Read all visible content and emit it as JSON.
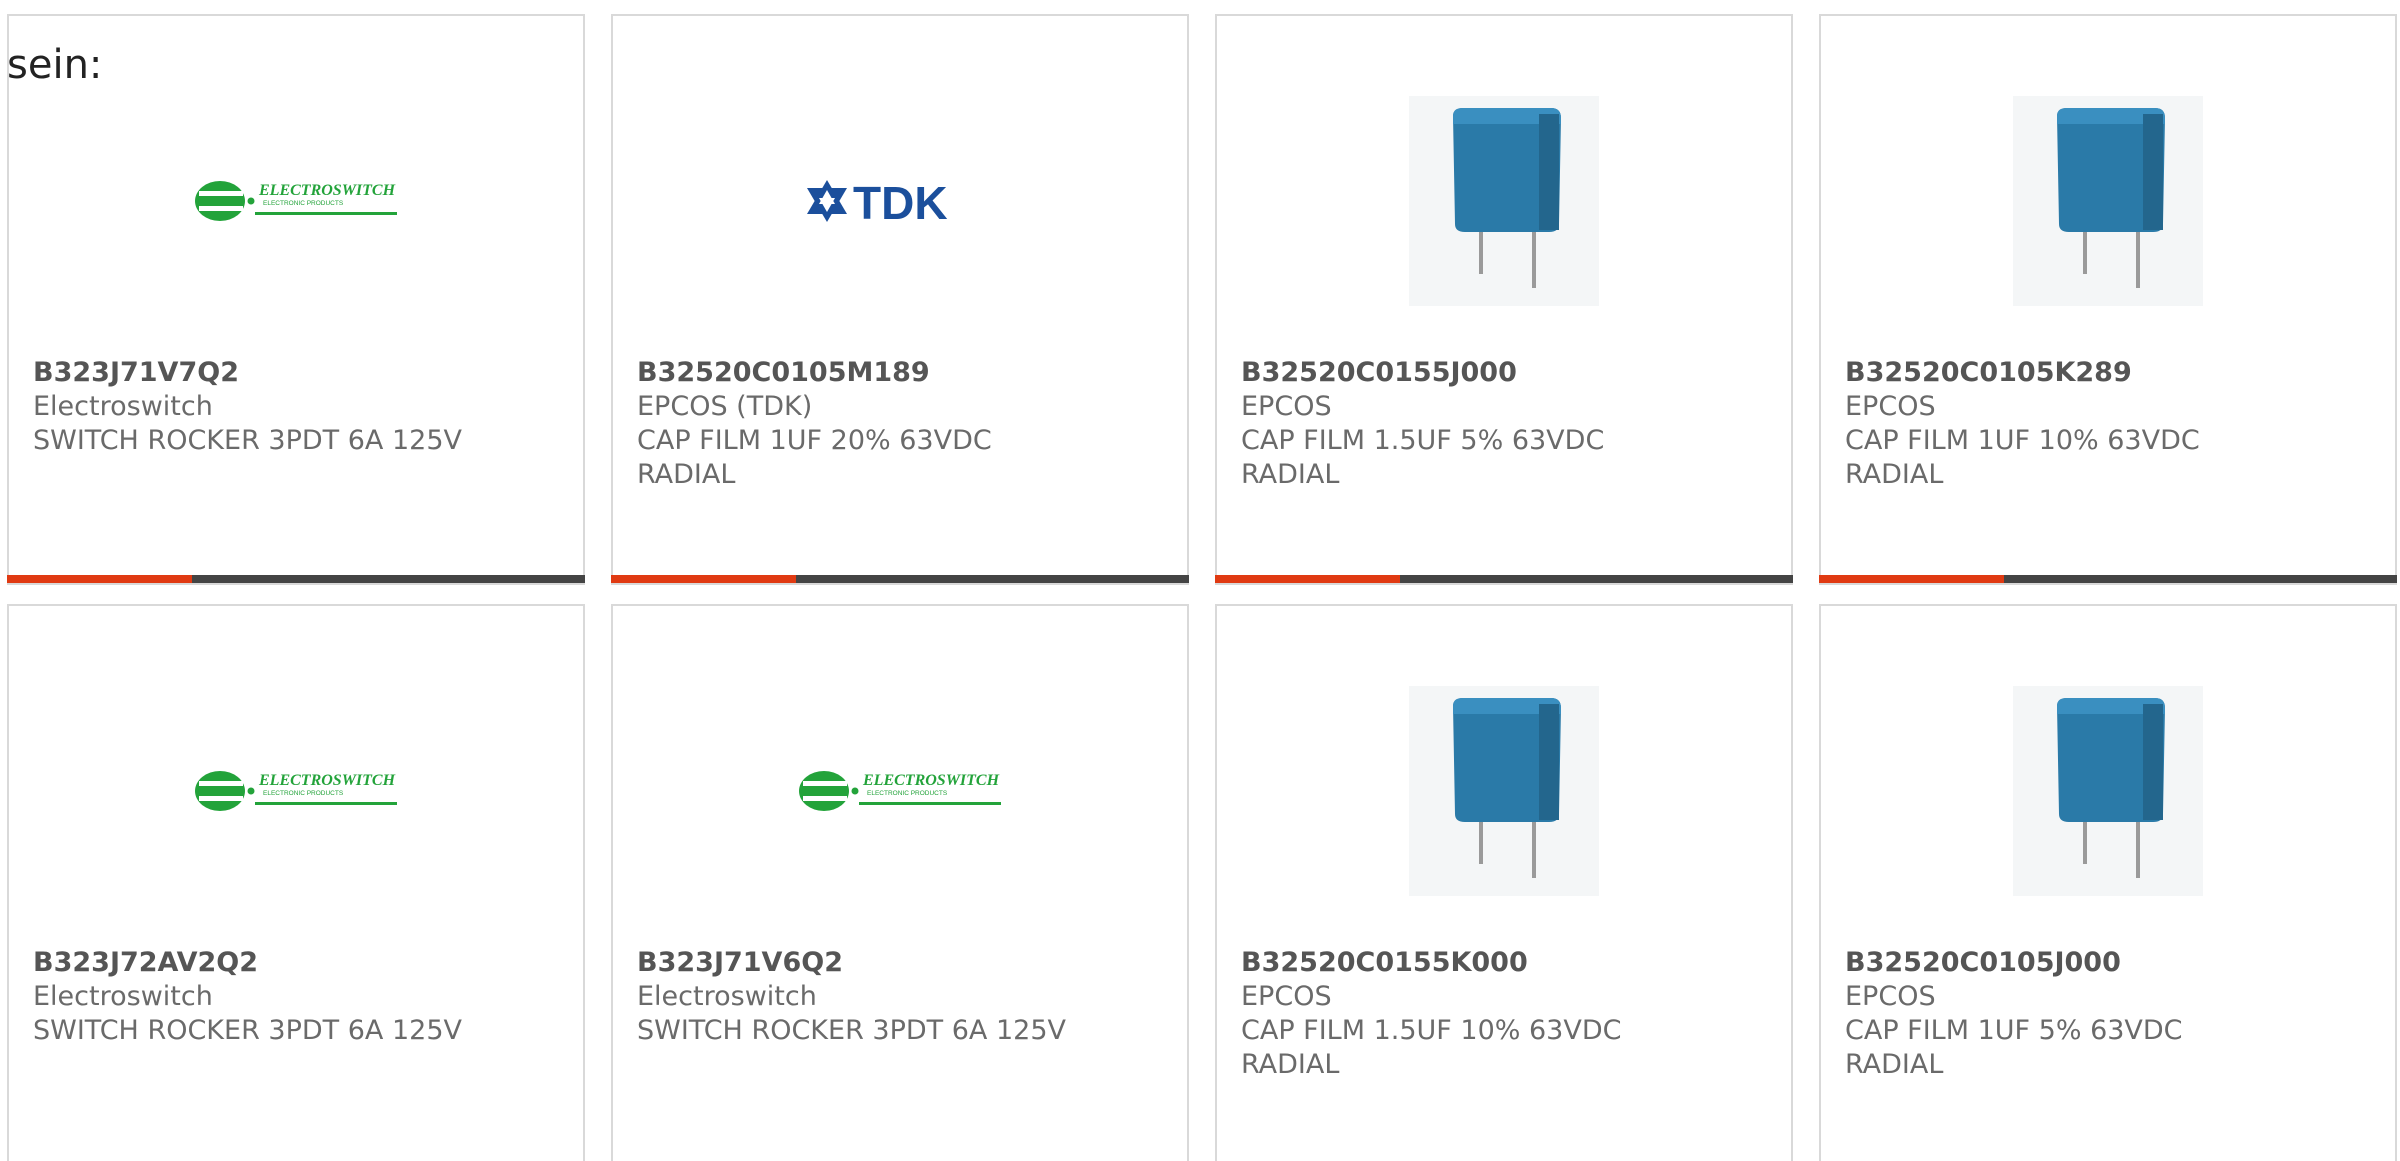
{
  "intro_text": "sein:",
  "colors": {
    "accent": "#e03a12",
    "bar_track": "#444444",
    "electroswitch_green": "#23a33a",
    "tdk_blue": "#1b4f9c",
    "capacitor_blue": "#2a7aa8"
  },
  "cards": [
    {
      "part_number": "B323J71V7Q2",
      "manufacturer": "Electroswitch",
      "desc_1": "SWITCH ROCKER 3PDT 6A 125V",
      "desc_2": "",
      "image": "electroswitch-logo",
      "logo_text": "ELECTROSWITCH",
      "logo_subtext": "ELECTRONIC PRODUCTS",
      "progress": 0.32
    },
    {
      "part_number": "B32520C0105M189",
      "manufacturer": "EPCOS (TDK)",
      "desc_1": "CAP FILM 1UF 20% 63VDC",
      "desc_2": "RADIAL",
      "image": "tdk-logo",
      "logo_text": "TDK",
      "progress": 0.32
    },
    {
      "part_number": "B32520C0155J000",
      "manufacturer": "EPCOS",
      "desc_1": "CAP FILM 1.5UF 5% 63VDC",
      "desc_2": "RADIAL",
      "image": "film-capacitor",
      "progress": 0.32
    },
    {
      "part_number": "B32520C0105K289",
      "manufacturer": "EPCOS",
      "desc_1": "CAP FILM 1UF 10% 63VDC",
      "desc_2": "RADIAL",
      "image": "film-capacitor",
      "progress": 0.32
    },
    {
      "part_number": "B323J72AV2Q2",
      "manufacturer": "Electroswitch",
      "desc_1": "SWITCH ROCKER 3PDT 6A 125V",
      "desc_2": "",
      "image": "electroswitch-logo",
      "logo_text": "ELECTROSWITCH",
      "logo_subtext": "ELECTRONIC PRODUCTS"
    },
    {
      "part_number": "B323J71V6Q2",
      "manufacturer": "Electroswitch",
      "desc_1": "SWITCH ROCKER 3PDT 6A 125V",
      "desc_2": "",
      "image": "electroswitch-logo",
      "logo_text": "ELECTROSWITCH",
      "logo_subtext": "ELECTRONIC PRODUCTS"
    },
    {
      "part_number": "B32520C0155K000",
      "manufacturer": "EPCOS",
      "desc_1": "CAP FILM 1.5UF 10% 63VDC",
      "desc_2": "RADIAL",
      "image": "film-capacitor"
    },
    {
      "part_number": "B32520C0105J000",
      "manufacturer": "EPCOS",
      "desc_1": "CAP FILM 1UF 5% 63VDC",
      "desc_2": "RADIAL",
      "image": "film-capacitor"
    }
  ]
}
